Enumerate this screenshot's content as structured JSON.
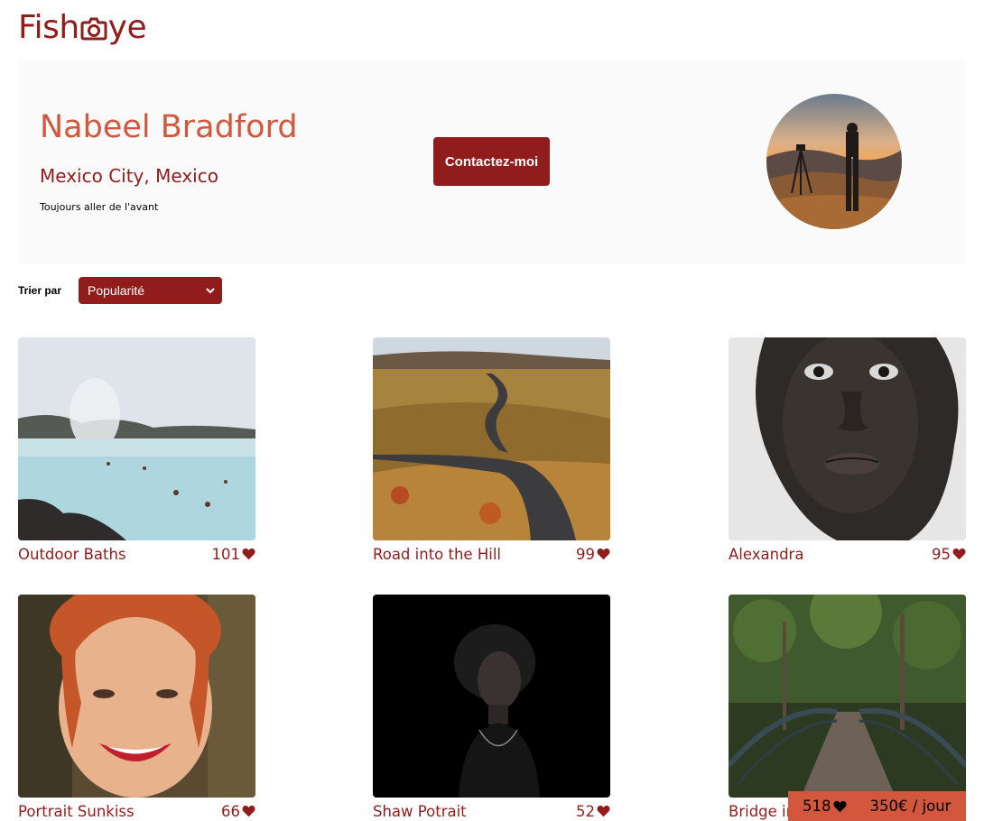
{
  "brand": {
    "name_left": "Fish",
    "name_right": "ye",
    "logo_icon": "camera-icon"
  },
  "photographer": {
    "name": "Nabeel Bradford",
    "location": "Mexico City, Mexico",
    "tagline": "Toujours aller de l'avant",
    "contact_label": "Contactez-moi",
    "portrait_icon": "photographer-portrait"
  },
  "sort": {
    "label": "Trier par",
    "selected": "Popularité"
  },
  "media": [
    {
      "title": "Outdoor Baths",
      "likes": "101"
    },
    {
      "title": "Road into the Hill",
      "likes": "99"
    },
    {
      "title": "Alexandra",
      "likes": "95"
    },
    {
      "title": "Portrait Sunkiss",
      "likes": "66"
    },
    {
      "title": "Shaw Potrait",
      "likes": "52"
    },
    {
      "title": "Bridge into the Forest",
      "likes": ""
    }
  ],
  "summary": {
    "total_likes": "518",
    "price": "350€ / jour"
  },
  "colors": {
    "primary": "#901C1C",
    "secondary": "#D3573C",
    "header_bg": "#FAFAFA"
  }
}
